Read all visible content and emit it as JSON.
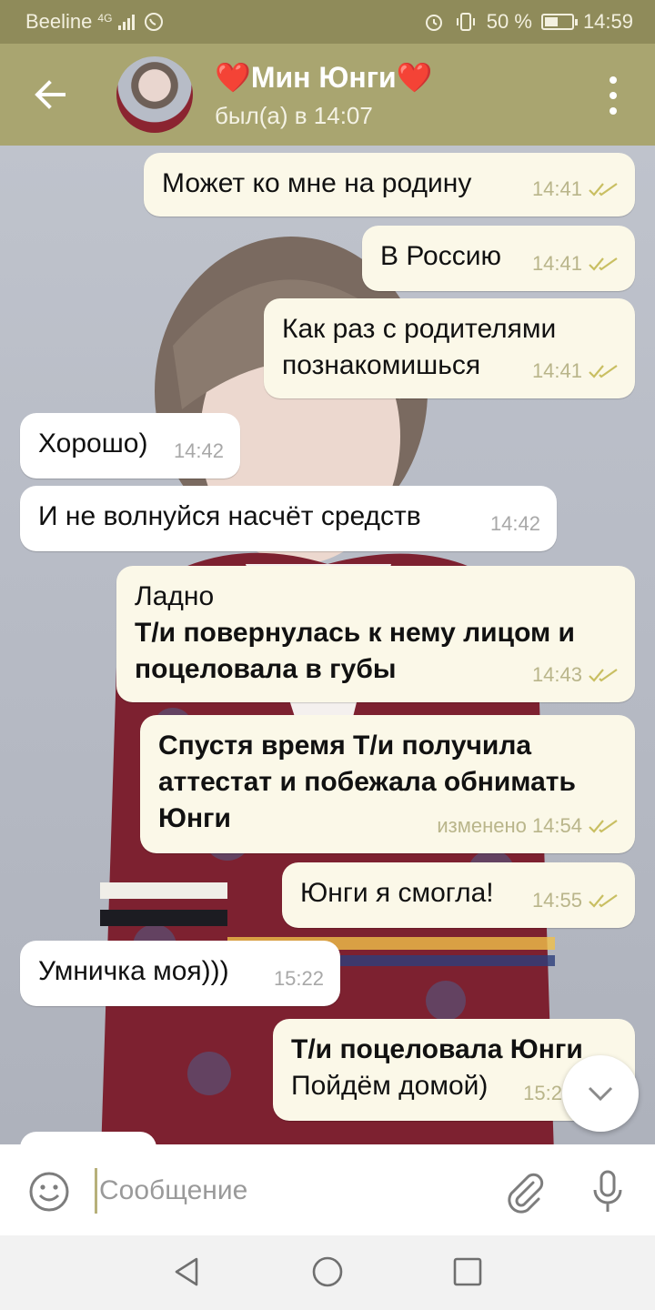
{
  "status_bar": {
    "carrier": "Beeline",
    "network": "4G",
    "battery": "50 %",
    "battery_level": 0.5,
    "time": "14:59"
  },
  "header": {
    "contact_name": "❤️Мин Юнги❤️",
    "last_seen": "был(а) в 14:07"
  },
  "messages": [
    {
      "dir": "out",
      "text": "Может ко мне на родину",
      "time": "14:41",
      "bold": false
    },
    {
      "dir": "out",
      "text": "В Россию",
      "time": "14:41",
      "bold": false
    },
    {
      "dir": "out",
      "text": "Как раз с родителями\nпознакомишься",
      "time": "14:41",
      "bold": false
    },
    {
      "dir": "in",
      "text": "Хорошо)",
      "time": "14:42"
    },
    {
      "dir": "in",
      "text": "И не волнуйся насчёт средств",
      "time": "14:42"
    },
    {
      "dir": "out",
      "text": "Ладно",
      "text_bold": "Т/и повернулась к нему лицом и\nпоцеловала в губы",
      "time": "14:43"
    },
    {
      "dir": "out",
      "text": "Спустя время Т/и получила\nаттестат и побежала обнимать\nЮнги",
      "time": "изменено 14:54",
      "bold": true
    },
    {
      "dir": "out",
      "text": "Юнги я смогла!",
      "time": "14:55",
      "bold": false
    },
    {
      "dir": "in",
      "text": "Умничка моя)))",
      "time": "15:22"
    },
    {
      "dir": "out",
      "text": "Т/и поцеловала Юнги",
      "text_extra": "Пойдём домой)",
      "time": "15:2",
      "bold": false
    }
  ],
  "input": {
    "placeholder": "Сообщение"
  },
  "colors": {
    "header": "#a9a570",
    "status_bar": "#8f8b5a",
    "outgoing_bubble": "#fbf8e8",
    "incoming_bubble": "#ffffff",
    "read_ticks": "#c9bf62"
  },
  "icons": [
    "back-arrow-icon",
    "more-vert-icon",
    "double-check-icon",
    "chevron-down-icon",
    "emoji-icon",
    "paperclip-icon",
    "microphone-icon",
    "nav-back-icon",
    "nav-home-icon",
    "nav-recent-icon"
  ]
}
